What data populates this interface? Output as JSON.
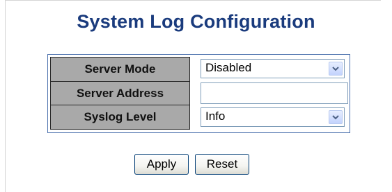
{
  "page": {
    "title": "System Log Configuration"
  },
  "form": {
    "rows": [
      {
        "label": "Server Mode",
        "value": "Disabled",
        "control": "select"
      },
      {
        "label": "Server Address",
        "value": "",
        "control": "text"
      },
      {
        "label": "Syslog Level",
        "value": "Info",
        "control": "select"
      }
    ]
  },
  "buttons": {
    "apply": "Apply",
    "reset": "Reset"
  },
  "icons": {
    "dropdown": "chevron-down-icon"
  },
  "colors": {
    "title": "#1a3b7d",
    "label_cell_bg": "#a9a9a9",
    "table_border": "#4a70ad",
    "dropdown_arrow": "#4d6185"
  }
}
